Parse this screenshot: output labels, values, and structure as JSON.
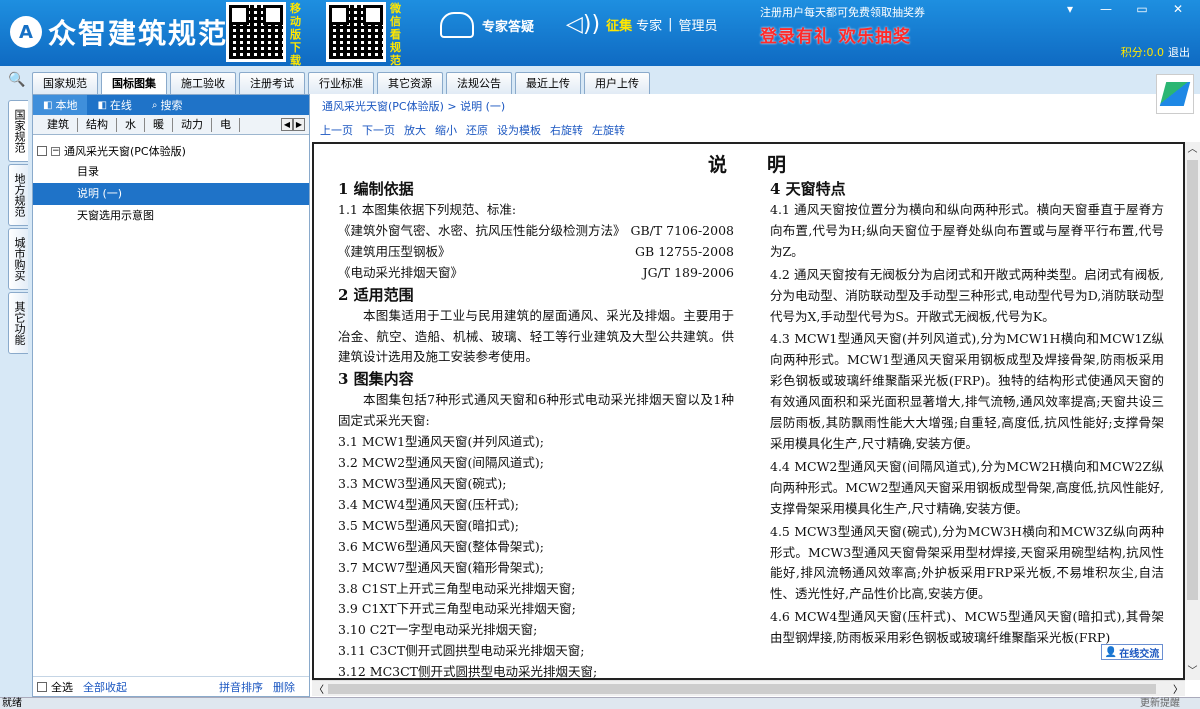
{
  "header": {
    "logo_text": "众智建筑规范",
    "qr_mobile_caption": "移动版下载",
    "qr_wechat_caption": "微信看规范",
    "expert_label": "专家答疑",
    "collect_label": "征集",
    "collect_expert": "专家",
    "collect_sep": "|",
    "collect_admin": "管理员",
    "promo_small": "注册用户每天都可免费领取抽奖券",
    "promo_big": "登录有礼  欢乐抽奖",
    "points_label": "积分:0.0",
    "logout_label": "退出",
    "window_controls": [
      "▾",
      "—",
      "▭",
      "✕"
    ]
  },
  "tabs": [
    {
      "label": "国家规范",
      "active": false
    },
    {
      "label": "国标图集",
      "active": true
    },
    {
      "label": "施工验收",
      "active": false
    },
    {
      "label": "注册考试",
      "active": false
    },
    {
      "label": "行业标准",
      "active": false
    },
    {
      "label": "其它资源",
      "active": false
    },
    {
      "label": "法规公告",
      "active": false
    },
    {
      "label": "最近上传",
      "active": false
    },
    {
      "label": "用户上传",
      "active": false
    }
  ],
  "vtabs": [
    {
      "label": "国家规范",
      "active": true
    },
    {
      "label": "地方规范",
      "active": false
    },
    {
      "label": "城市购买",
      "active": false
    },
    {
      "label": "其它功能",
      "active": false
    }
  ],
  "leftpanel": {
    "top": [
      "本地",
      "在线",
      "搜索"
    ],
    "categories": [
      "建筑",
      "结构",
      "水",
      "暖",
      "动力",
      "电"
    ],
    "tree_root": "通风采光天窗(PC体验版)",
    "tree_items": [
      {
        "label": "目录",
        "selected": false
      },
      {
        "label": "说明 (一)",
        "selected": true
      },
      {
        "label": "天窗选用示意图",
        "selected": false
      }
    ],
    "bottom": {
      "select_all": "全选",
      "collapse_all": "全部收起",
      "pinyin_sort": "拼音排序",
      "delete": "删除"
    }
  },
  "breadcrumb": "通风采光天窗(PC体验版) > 说明 (一)",
  "toolbar": [
    "上一页",
    "下一页",
    "放大",
    "缩小",
    "还原",
    "设为模板",
    "右旋转",
    "左旋转"
  ],
  "document": {
    "title": "说明",
    "left": {
      "s1_heading": "1  编制依据",
      "s1_p": "1.1  本图集依据下列规范、标准:",
      "refs": [
        {
          "name": "《建筑外窗气密、水密、抗风压性能分级检测方法》",
          "code": "GB/T 7106-2008"
        },
        {
          "name": "《建筑用压型钢板》",
          "code": "GB 12755-2008"
        },
        {
          "name": "《电动采光排烟天窗》",
          "code": "JG/T 189-2006"
        }
      ],
      "s2_heading": "2  适用范围",
      "s2_p": "本图集适用于工业与民用建筑的屋面通风、采光及排烟。主要用于冶金、航空、造船、机械、玻璃、轻工等行业建筑及大型公共建筑。供建筑设计选用及施工安装参考使用。",
      "s3_heading": "3  图集内容",
      "s3_p": "本图集包括7种形式通风天窗和6种形式电动采光排烟天窗以及1种固定式采光天窗:",
      "items": [
        "3.1  MCW1型通风天窗(并列风道式);",
        "3.2  MCW2型通风天窗(间隔风道式);",
        "3.3  MCW3型通风天窗(碗式);",
        "3.4  MCW4型通风天窗(压杆式);",
        "3.5  MCW5型通风天窗(暗扣式);",
        "3.6  MCW6型通风天窗(整体骨架式);",
        "3.7  MCW7型通风天窗(箱形骨架式);",
        "3.8  C1ST上开式三角型电动采光排烟天窗;",
        "3.9  C1XT下开式三角型电动采光排烟天窗;",
        "3.10 C2T一字型电动采光排烟天窗;",
        "3.11 C3CT侧开式圆拱型电动采光排烟天窗;",
        "3.12 MC3CT侧开式圆拱型电动采光排烟天窗;"
      ]
    },
    "right": {
      "s4_heading": "4  天窗特点",
      "paras": [
        "4.1  通风天窗按位置分为横向和纵向两种形式。横向天窗垂直于屋脊方向布置,代号为H;纵向天窗位于屋脊处纵向布置或与屋脊平行布置,代号为Z。",
        "4.2  通风天窗按有无阀板分为启闭式和开敞式两种类型。启闭式有阀板,分为电动型、消防联动型及手动型三种形式,电动型代号为D,消防联动型代号为X,手动型代号为S。开敞式无阀板,代号为K。",
        "4.3  MCW1型通风天窗(并列风道式),分为MCW1H横向和MCW1Z纵向两种形式。MCW1型通风天窗采用钢板成型及焊接骨架,防雨板采用彩色钢板或玻璃纤维聚酯采光板(FRP)。独特的结构形式使通风天窗的有效通风面积和采光面积显著增大,排气流畅,通风效率提高;天窗共设三层防雨板,其防飘雨性能大大增强;自重轻,高度低,抗风性能好;支撑骨架采用模具化生产,尺寸精确,安装方便。",
        "4.4  MCW2型通风天窗(间隔风道式),分为MCW2H横向和MCW2Z纵向两种形式。MCW2型通风天窗采用钢板成型骨架,高度低,抗风性能好,支撑骨架采用模具化生产,尺寸精确,安装方便。",
        "4.5  MCW3型通风天窗(碗式),分为MCW3H横向和MCW3Z纵向两种形式。MCW3型通风天窗骨架采用型材焊接,天窗采用碗型结构,抗风性能好,排风流畅通风效率高;外护板采用FRP采光板,不易堆积灰尘,自洁性、透光性好,产品性价比高,安装方便。",
        "4.6  MCW4型通风天窗(压杆式)、MCW5型通风天窗(暗扣式),其骨架由型钢焊接,防雨板采用彩色钢板或玻璃纤维聚酯采光板(FRP)"
      ]
    }
  },
  "chat_badge": "在线交流",
  "status": {
    "left": "就绪",
    "right": "更新提醒"
  }
}
